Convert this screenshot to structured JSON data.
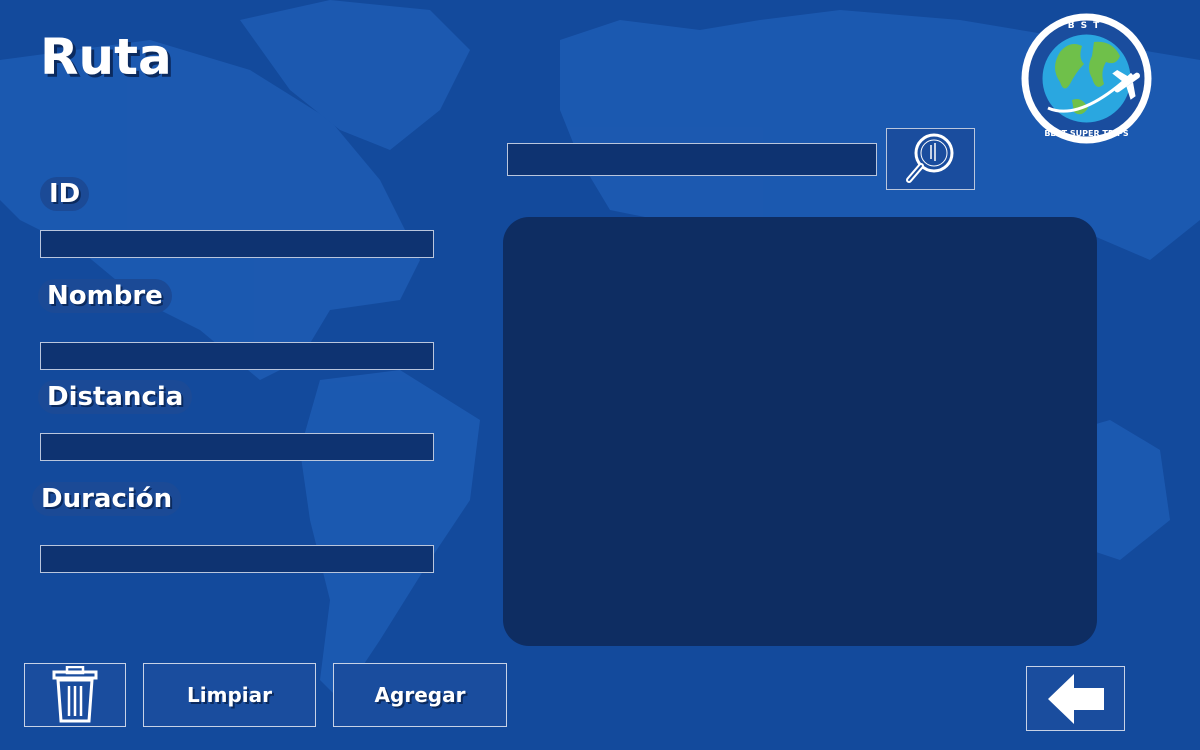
{
  "page": {
    "title": "Ruta"
  },
  "form": {
    "id_label": "ID",
    "nombre_label": "Nombre",
    "distancia_label": "Distancia",
    "duracion_label": "Duración",
    "id_value": "",
    "nombre_value": "",
    "distancia_value": "",
    "duracion_value": ""
  },
  "search": {
    "value": "",
    "placeholder": ""
  },
  "buttons": {
    "limpiar": "Limpiar",
    "agregar": "Agregar"
  },
  "logo": {
    "top_text": "BST",
    "ring_text": "BEST SUPER TRIPS"
  },
  "icons": {
    "search": "magnifier-icon",
    "delete": "trash-icon",
    "back": "arrow-left-icon"
  },
  "colors": {
    "background": "#134a9c",
    "panel": "#0e2d62",
    "field": "#0e3371",
    "button": "#1a4d9e"
  }
}
